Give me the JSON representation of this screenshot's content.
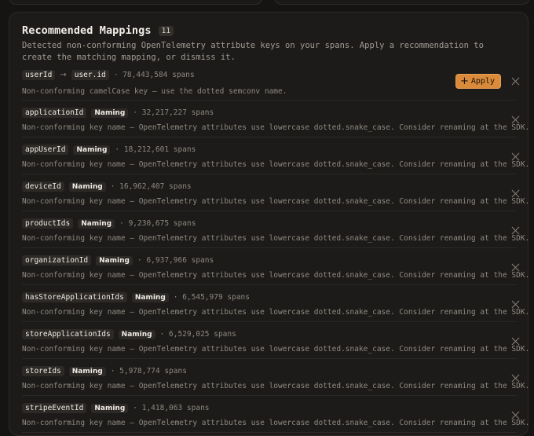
{
  "panel": {
    "title": "Recommended Mappings",
    "count": "11",
    "description": "Detected non-conforming OpenTelemetry attribute keys on your spans. Apply a recommendation to create the matching mapping, or dismiss it."
  },
  "first": {
    "from": "userId",
    "arrow": "→",
    "to": "user.id",
    "spans": "· 78,443,584 spans",
    "note": "Non-conforming camelCase key — use the dotted semconv name.",
    "apply_label": "Apply",
    "apply_icon": "plus-icon",
    "dismiss_icon": "close-icon"
  },
  "items": [
    {
      "key": "applicationId",
      "kind": "Naming",
      "spans": "· 32,217,227 spans",
      "note": "Non-conforming key name — OpenTelemetry attributes use lowercase dotted.snake_case. Consider renaming at the SDK."
    },
    {
      "key": "appUserId",
      "kind": "Naming",
      "spans": "· 18,212,601 spans",
      "note": "Non-conforming key name — OpenTelemetry attributes use lowercase dotted.snake_case. Consider renaming at the SDK."
    },
    {
      "key": "deviceId",
      "kind": "Naming",
      "spans": "· 16,962,407 spans",
      "note": "Non-conforming key name — OpenTelemetry attributes use lowercase dotted.snake_case. Consider renaming at the SDK."
    },
    {
      "key": "productIds",
      "kind": "Naming",
      "spans": "· 9,230,675 spans",
      "note": "Non-conforming key name — OpenTelemetry attributes use lowercase dotted.snake_case. Consider renaming at the SDK."
    },
    {
      "key": "organizationId",
      "kind": "Naming",
      "spans": "· 6,937,966 spans",
      "note": "Non-conforming key name — OpenTelemetry attributes use lowercase dotted.snake_case. Consider renaming at the SDK."
    },
    {
      "key": "hasStoreApplicationIds",
      "kind": "Naming",
      "spans": "· 6,545,979 spans",
      "note": "Non-conforming key name — OpenTelemetry attributes use lowercase dotted.snake_case. Consider renaming at the SDK."
    },
    {
      "key": "storeApplicationIds",
      "kind": "Naming",
      "spans": "· 6,529,025 spans",
      "note": "Non-conforming key name — OpenTelemetry attributes use lowercase dotted.snake_case. Consider renaming at the SDK."
    },
    {
      "key": "storeIds",
      "kind": "Naming",
      "spans": "· 5,978,774 spans",
      "note": "Non-conforming key name — OpenTelemetry attributes use lowercase dotted.snake_case. Consider renaming at the SDK."
    },
    {
      "key": "stripeEventId",
      "kind": "Naming",
      "spans": "· 1,418,063 spans",
      "note": "Non-conforming key name — OpenTelemetry attributes use lowercase dotted.snake_case. Consider renaming at the SDK."
    }
  ],
  "colors": {
    "background": "#161412",
    "panel": "#1d1b19",
    "accent": "#d98a3a"
  }
}
